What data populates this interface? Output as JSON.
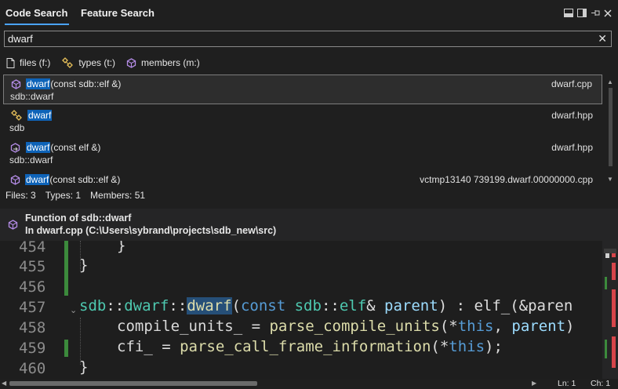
{
  "tabs": [
    {
      "label": "Code Search"
    },
    {
      "label": "Feature Search"
    }
  ],
  "search": {
    "value": "dwarf"
  },
  "filters": [
    {
      "label": "files (f:)"
    },
    {
      "label": "types (t:)"
    },
    {
      "label": "members (m:)"
    }
  ],
  "results": [
    {
      "name": "dwarf",
      "signature": "(const sdb::elf &)",
      "scope": "sdb::dwarf",
      "file": "dwarf.cpp",
      "icon": "method-cube-icon"
    },
    {
      "name": "dwarf",
      "signature": "",
      "scope": "sdb",
      "file": "dwarf.hpp",
      "icon": "class-icon"
    },
    {
      "name": "dwarf",
      "signature": "(const elf &)",
      "scope": "sdb::dwarf",
      "file": "dwarf.hpp",
      "icon": "constructor-icon"
    },
    {
      "name": "dwarf",
      "signature": "(const sdb::elf &)",
      "scope": "",
      "file": "vctmp13140  739199.dwarf.00000000.cpp",
      "icon": "method-cube-icon"
    }
  ],
  "counts": {
    "files": "Files: 3",
    "types": "Types: 1",
    "members": "Members: 51"
  },
  "info": {
    "title": "Function of sdb::dwarf",
    "location": "In dwarf.cpp (C:\\Users\\sybrand\\projects\\sdb_new\\src)"
  },
  "editor": {
    "line_numbers": [
      "454",
      "455",
      "456",
      "457",
      "458",
      "459",
      "460"
    ],
    "lines": {
      "l454": "}",
      "l455": "}",
      "l457_ns1": "sdb",
      "l457_sep1": "::",
      "l457_ns2": "dwarf",
      "l457_sep2": "::",
      "l457_fn": "dwarf",
      "l457_open": "(",
      "l457_kw": "const",
      "l457_ns3": " sdb",
      "l457_sep3": "::",
      "l457_type": "elf",
      "l457_amp": "& ",
      "l457_param": "parent",
      "l457_rest": ") : elf_(&paren",
      "l458_var": "compile_units_",
      "l458_eq": " = ",
      "l458_fn": "parse_compile_units",
      "l458_open": "(*",
      "l458_this": "this",
      "l458_comma": ", ",
      "l458_param": "parent",
      "l458_tail": ")",
      "l459_var": "cfi_",
      "l459_eq": " = ",
      "l459_fn": "parse_call_frame_information",
      "l459_open": "(*",
      "l459_this": "this",
      "l459_close": ");",
      "l460": "}"
    }
  },
  "status": {
    "line": "Ln: 1",
    "col": "Ch: 1"
  },
  "colors": {
    "accent": "#4aa3ff",
    "highlight": "#0e63b8",
    "method": "#b48ce6",
    "class": "#e8c15a",
    "gutter_green": "#3c8a3c"
  }
}
